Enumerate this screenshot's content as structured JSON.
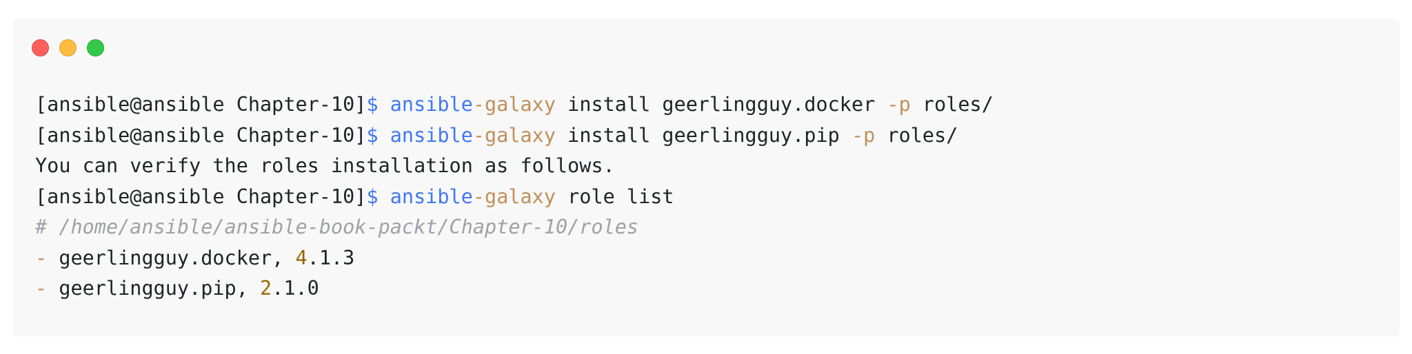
{
  "window": {
    "controls": [
      "close",
      "minimize",
      "maximize"
    ]
  },
  "code": {
    "lines": [
      {
        "prompt": "[ansible@ansible Chapter-10]",
        "dollar": "$",
        "cmd_a": " ansible",
        "cmd_b": "-galaxy",
        "rest1": " install geerlingguy.docker ",
        "flag": "-p",
        "rest2": " roles/"
      },
      {
        "prompt": "[ansible@ansible Chapter-10]",
        "dollar": "$",
        "cmd_a": " ansible",
        "cmd_b": "-galaxy",
        "rest1": " install geerlingguy.pip ",
        "flag": "-p",
        "rest2": " roles/"
      },
      {
        "text": "You can verify the roles installation as follows."
      },
      {
        "prompt": "[ansible@ansible Chapter-10]",
        "dollar": "$",
        "cmd_a": " ansible",
        "cmd_b": "-galaxy",
        "rest1": " role list"
      },
      {
        "comment": "# /home/ansible/ansible-book-packt/Chapter-10/roles"
      },
      {
        "dash": "-",
        "name": " geerlingguy.docker, ",
        "major": "4",
        "rest": ".1.3"
      },
      {
        "dash": "-",
        "name": " geerlingguy.pip, ",
        "major": "2",
        "rest": ".1.0"
      }
    ]
  },
  "colors": {
    "background": "#f8f8f8",
    "keyword_blue": "#4078f2",
    "accent_orange": "#c18f5a",
    "number": "#986801",
    "comment": "#a0a1a7"
  }
}
